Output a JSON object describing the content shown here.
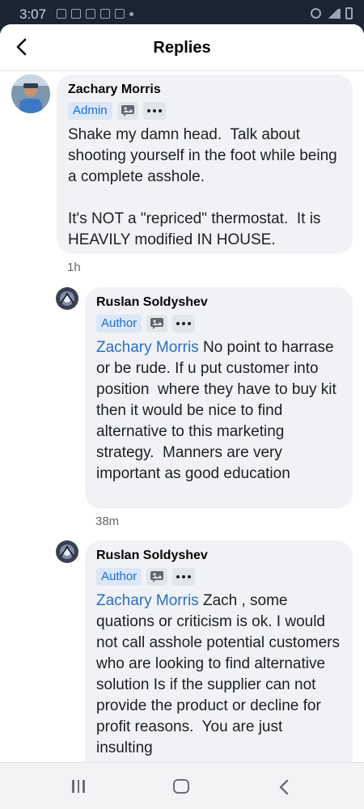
{
  "status_bar": {
    "time": "3:07"
  },
  "header": {
    "title": "Replies",
    "back_icon": "chevron-left-icon"
  },
  "comments": [
    {
      "author": "Zachary Morris",
      "badge": "Admin",
      "mention": "",
      "text": "Shake my damn head.  Talk about shooting yourself in the foot while being a complete asshole.\n\nIt's NOT a \"repriced\" thermostat.  It is HEAVILY modified IN HOUSE.",
      "time": "1h"
    },
    {
      "author": "Ruslan Soldyshev",
      "badge": "Author",
      "mention": "Zachary Morris",
      "text": " No point to harrase or be rude. If u put customer into position  where they have to buy kit then it would be nice to find alternative to this marketing strategy.  Manners are very important as good education",
      "time": "38m"
    },
    {
      "author": "Ruslan Soldyshev",
      "badge": "Author",
      "mention": "Zachary Morris",
      "text": " Zach , some quations or criticism is ok. I would not call asshole potential customers who are looking to find alternative solution Is if the supplier can not provide the product or decline for profit reasons.  You are just insulting",
      "time": ""
    }
  ],
  "colors": {
    "mention": "#2a6fc4",
    "badge_bg": "#dbe7f7",
    "bubble_bg": "#f0f2f5"
  }
}
